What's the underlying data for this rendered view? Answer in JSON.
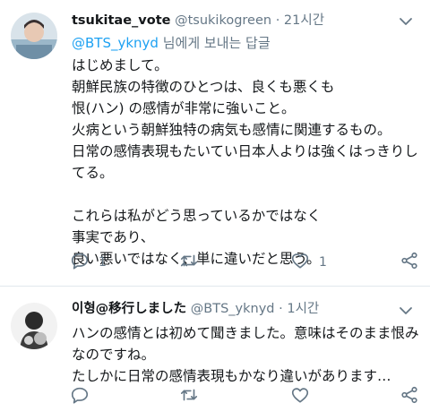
{
  "tweets": [
    {
      "name": "tsukitae_vote",
      "handle": "@tsukikogreen",
      "dot": "·",
      "time": "21시간",
      "reply_to_handle": "@BTS_yknyd",
      "reply_to_suffix": " 님에게 보내는 답글",
      "lines": [
        "はじめまして。",
        "朝鮮民族の特徴のひとつは、良くも悪くも",
        "恨(ハン) の感情が非常に強いこと。",
        "火病という朝鮮独特の病気も感情に関連するもの。",
        "日常の感情表現もたいてい日本人よりは強くはっきりし",
        "てる。",
        "",
        "これらは私がどう思っているかではなく",
        "事実であり、",
        "良い悪いではなく、単に違いだと思う。"
      ],
      "reply_count": "1",
      "retweet_count": "",
      "like_count": "1",
      "icons": {
        "reply": "reply-icon",
        "retweet": "retweet-icon",
        "like": "heart-icon",
        "share": "share-icon",
        "menu": "chevron-down-icon"
      }
    },
    {
      "name": "이형@移行しました",
      "handle": "@BTS_yknyd",
      "dot": "·",
      "time": "1시간",
      "lines": [
        "ハンの感情とは初めて聞きました。意味はそのまま恨み",
        "なのですね。",
        "たしかに日常の感情表現もかなり違いがあります…"
      ],
      "reply_count": "",
      "retweet_count": "",
      "like_count": "",
      "icons": {
        "reply": "reply-icon",
        "retweet": "retweet-icon",
        "like": "heart-icon",
        "share": "share-icon",
        "menu": "chevron-down-icon"
      }
    }
  ],
  "colors": {
    "text": "#14171a",
    "secondary": "#657786",
    "link": "#1da1f2",
    "divider": "#e1e8ed"
  }
}
